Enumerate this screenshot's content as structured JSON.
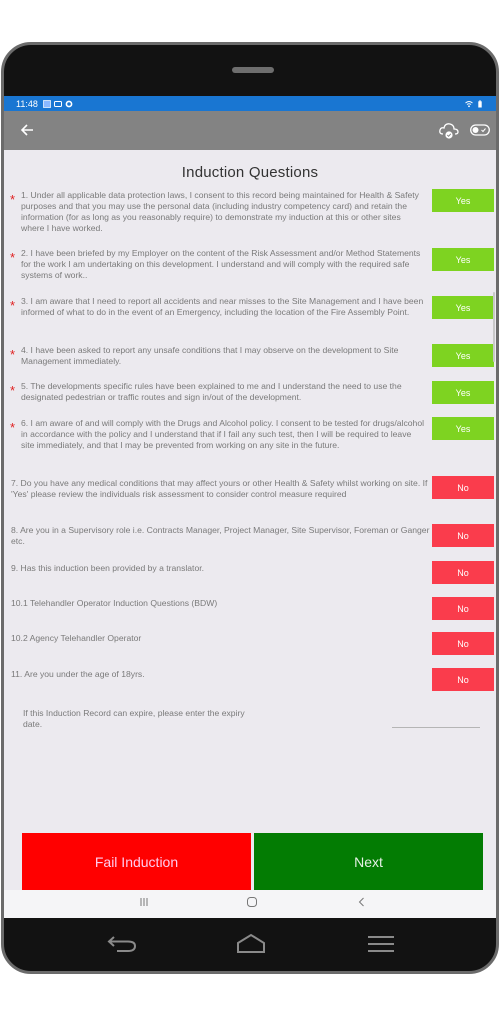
{
  "status_bar": {
    "time": "11:48",
    "left_icons": [
      "nfc-icon",
      "message-icon",
      "settings-icon"
    ],
    "right_icons": [
      "wifi-icon",
      "battery-icon"
    ]
  },
  "app_bar": {
    "back_icon": "arrow-left-icon",
    "actions": [
      "cloud-sync-icon",
      "toggle-icon"
    ]
  },
  "page_title": "Induction Questions",
  "questions": [
    {
      "required": true,
      "text": "1. Under all applicable data protection laws, I consent to this record being maintained for Health & Safety purposes and that you may use the personal data (including industry competency card) and retain the information (for as long as you reasonably require) to demonstrate my induction at this or other  sites where I have worked.",
      "answer": "Yes"
    },
    {
      "required": true,
      "text": "2. I have been briefed by my Employer on the content of the Risk Assessment and/or Method Statements for the work I am undertaking on this development. I understand and will comply with the required safe systems of work..",
      "answer": "Yes"
    },
    {
      "required": true,
      "text": "3. I am aware that I need to report all accidents and near misses to the Site Management and I have been informed of what to do in the event of an Emergency, including the location of the Fire Assembly Point.",
      "answer": "Yes"
    },
    {
      "required": true,
      "text": "4. I have been asked to report any unsafe conditions that I may observe on the development to Site Management immediately.",
      "answer": "Yes"
    },
    {
      "required": true,
      "text": "5. The developments specific rules have been explained to me and I understand the need to use the designated pedestrian or traffic routes and sign in/out of the development.",
      "answer": "Yes"
    },
    {
      "required": true,
      "text": "6. I am aware of and will comply with the Drugs and Alcohol policy. I consent to be tested for drugs/alcohol in accordance with the policy and I understand that if I fail any such test, then I will be required to leave site immediately, and that I may be prevented from working on any  site in the future.",
      "answer": "Yes"
    },
    {
      "required": false,
      "text": "7. Do you have any medical conditions that may affect yours or other Health & Safety whilst working on site. If 'Yes' please review the individuals risk assessment to consider control measure required",
      "answer": "No"
    },
    {
      "required": false,
      "text": "8. Are you in a Supervisory role i.e. Contracts Manager, Project Manager, Site Supervisor, Foreman or Ganger etc.",
      "answer": "No"
    },
    {
      "required": false,
      "text": "9.  Has this induction been provided by a translator.",
      "answer": "No"
    },
    {
      "required": false,
      "text": "10.1 Telehandler Operator Induction Questions (BDW)",
      "answer": "No"
    },
    {
      "required": false,
      "text": "10.2 Agency Telehandler Operator",
      "answer": "No"
    },
    {
      "required": false,
      "text": "11. Are you under the age of 18yrs.",
      "answer": "No"
    }
  ],
  "expiry": {
    "label": "If this Induction Record can expire, please enter the expiry date.",
    "value": ""
  },
  "buttons": {
    "fail": "Fail Induction",
    "next": "Next"
  },
  "colors": {
    "yes": "#7ed321",
    "no": "#fa3c4c",
    "fail": "#ff0000",
    "next": "#037c03",
    "status_bar": "#1976d2",
    "app_bar": "#838383"
  },
  "system_nav": [
    "recent-apps-icon",
    "home-icon",
    "back-icon"
  ],
  "hardware_nav": [
    "back-arrow-icon",
    "home-icon",
    "menu-icon"
  ]
}
